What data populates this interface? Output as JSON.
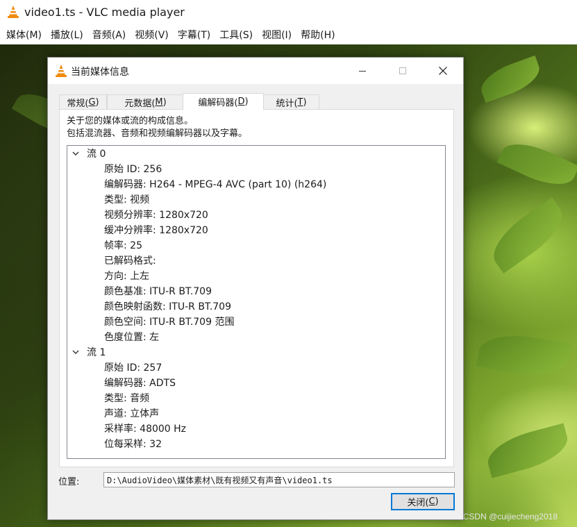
{
  "app": {
    "title": "video1.ts - VLC media player",
    "menu": [
      "媒体(M)",
      "播放(L)",
      "音频(A)",
      "视频(V)",
      "字幕(T)",
      "工具(S)",
      "视图(I)",
      "帮助(H)"
    ]
  },
  "dialog": {
    "title": "当前媒体信息",
    "tabs": [
      {
        "label": "常规(",
        "key": "G",
        "close": ")"
      },
      {
        "label": "元数据(",
        "key": "M",
        "close": ")"
      },
      {
        "label": "编解码器(",
        "key": "D",
        "close": ")"
      },
      {
        "label": "统计(",
        "key": "T",
        "close": ")"
      }
    ],
    "active_tab": 2,
    "description_line1": "关于您的媒体或流的构成信息。",
    "description_line2": "包括混流器、音频和视频编解码器以及字幕。",
    "streams": [
      {
        "label": "流 0",
        "items": [
          "原始 ID: 256",
          "编解码器: H264 - MPEG-4 AVC (part 10) (h264)",
          "类型: 视频",
          "视频分辨率: 1280x720",
          "缓冲分辨率: 1280x720",
          "帧率: 25",
          "已解码格式:",
          "方向: 上左",
          "颜色基准: ITU-R BT.709",
          "颜色映射函数: ITU-R BT.709",
          "颜色空间: ITU-R BT.709 范围",
          "色度位置: 左"
        ]
      },
      {
        "label": "流 1",
        "items": [
          "原始 ID: 257",
          "编解码器: ADTS",
          "类型: 音频",
          "声道: 立体声",
          "采样率: 48000 Hz",
          "位每采样: 32"
        ]
      }
    ],
    "location_label": "位置:",
    "location_value": "D:\\AudioVideo\\媒体素材\\既有视频又有声音\\video1.ts",
    "close_button": {
      "label": "关闭(",
      "key": "C",
      "close": ")"
    }
  },
  "watermark": "CSDN @cuijiecheng2018",
  "colors": {
    "accent": "#0078d7",
    "vlc_orange": "#f08a0c"
  }
}
